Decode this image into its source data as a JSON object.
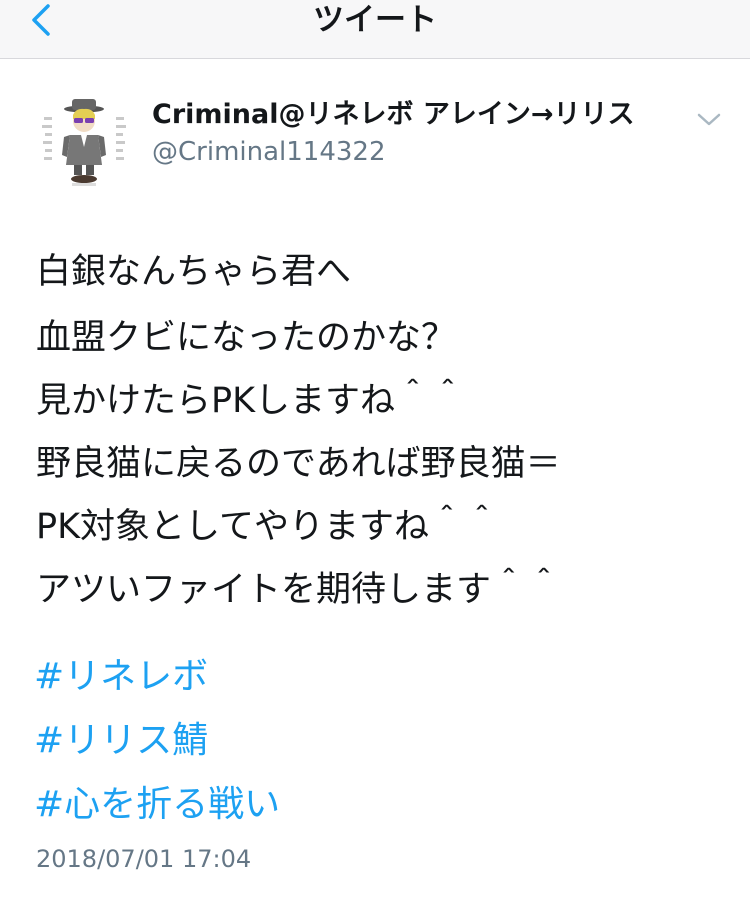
{
  "nav": {
    "title": "ツイート"
  },
  "author": {
    "display_name": "Criminal@リネレボ アレイン→リリス",
    "handle": "@Criminal114322"
  },
  "tweet": {
    "lines": [
      "白銀なんちゃら君へ",
      "血盟クビになったのかな？",
      "見かけたらPKしますね＾＾",
      "野良猫に戻るのであれば野良猫＝",
      "PK対象としてやりますね＾＾",
      "アツいファイトを期待します＾＾"
    ],
    "hashtags": [
      "#リネレボ",
      "#リリス鯖",
      "#心を折る戦い"
    ],
    "timestamp": "2018/07/01 17:04"
  },
  "colors": {
    "accent": "#1da1f2",
    "secondary_text": "#657786",
    "primary_text": "#14171a",
    "nav_background": "#f7f7f8"
  },
  "icons": {
    "back": "chevron-left-icon",
    "more": "chevron-down-icon"
  }
}
